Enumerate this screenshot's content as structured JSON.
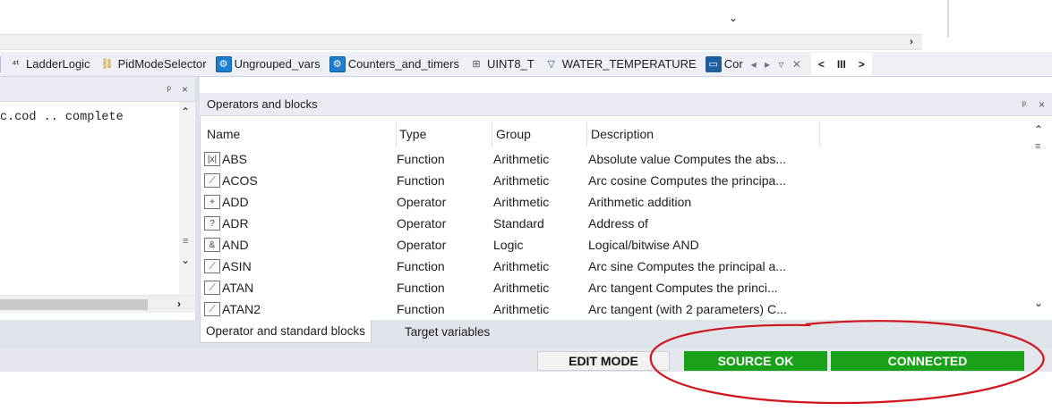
{
  "top": {
    "combo_arrow": "⌄",
    "scroll_right_arrow": "›"
  },
  "tabs": [
    {
      "label": "LadderLogic",
      "icon": "ladder-icon",
      "glyph": "⁴ᵗ"
    },
    {
      "label": "PidModeSelector",
      "icon": "pid-block-icon",
      "glyph": "⛓"
    },
    {
      "label": "Ungrouped_vars",
      "icon": "variables-group-icon",
      "glyph": "⚙"
    },
    {
      "label": "Counters_and_timers",
      "icon": "variables-group-icon",
      "glyph": "⚙"
    },
    {
      "label": "UINT8_T",
      "icon": "type-table-icon",
      "glyph": "⊞"
    },
    {
      "label": "WATER_TEMPERATURE",
      "icon": "filter-icon",
      "glyph": "▽"
    },
    {
      "label": "Cor",
      "icon": "config-icon",
      "glyph": "▭"
    }
  ],
  "tab_nav": {
    "glyphs": "◂ ▸ ▿ ✕"
  },
  "tab_scroll": {
    "left": "<",
    "mid": "III",
    "right": ">"
  },
  "left_panel": {
    "pin": "ᵖ",
    "close": "×",
    "console_line": "c.cod .. complete"
  },
  "ops_panel": {
    "title": "Operators and blocks",
    "pin": "ᵖ",
    "close": "×",
    "columns": [
      "Name",
      "Type",
      "Group",
      "Description"
    ],
    "rows": [
      {
        "icon": "abs-icon",
        "glyph": "|x|",
        "name": "ABS",
        "type": "Function",
        "group": "Arithmetic",
        "desc": "Absolute value Computes the abs..."
      },
      {
        "icon": "curve-icon",
        "glyph": "⟋",
        "name": "ACOS",
        "type": "Function",
        "group": "Arithmetic",
        "desc": "Arc cosine Computes the principa..."
      },
      {
        "icon": "plus-icon",
        "glyph": "+",
        "name": "ADD",
        "type": "Operator",
        "group": "Arithmetic",
        "desc": "Arithmetic addition"
      },
      {
        "icon": "question-icon",
        "glyph": "?",
        "name": "ADR",
        "type": "Operator",
        "group": "Standard",
        "desc": "Address of"
      },
      {
        "icon": "ampersand-icon",
        "glyph": "&",
        "name": "AND",
        "type": "Operator",
        "group": "Logic",
        "desc": "Logical/bitwise AND"
      },
      {
        "icon": "curve-icon",
        "glyph": "⟋",
        "name": "ASIN",
        "type": "Function",
        "group": "Arithmetic",
        "desc": "Arc sine Computes the principal a..."
      },
      {
        "icon": "curve-icon",
        "glyph": "⟋",
        "name": "ATAN",
        "type": "Function",
        "group": "Arithmetic",
        "desc": "Arc tangent Computes the princi..."
      },
      {
        "icon": "curve-icon",
        "glyph": "⟋",
        "name": "ATAN2",
        "type": "Function",
        "group": "Arithmetic",
        "desc": "Arc tangent (with 2 parameters) C..."
      }
    ]
  },
  "bottom_tabs": [
    "Operator and standard blocks",
    "Target variables"
  ],
  "status": {
    "edit_mode": "EDIT MODE",
    "source_ok": "SOURCE OK",
    "connected": "CONNECTED",
    "ok_color": "#19a11a",
    "annotation_color": "#d0161c"
  }
}
